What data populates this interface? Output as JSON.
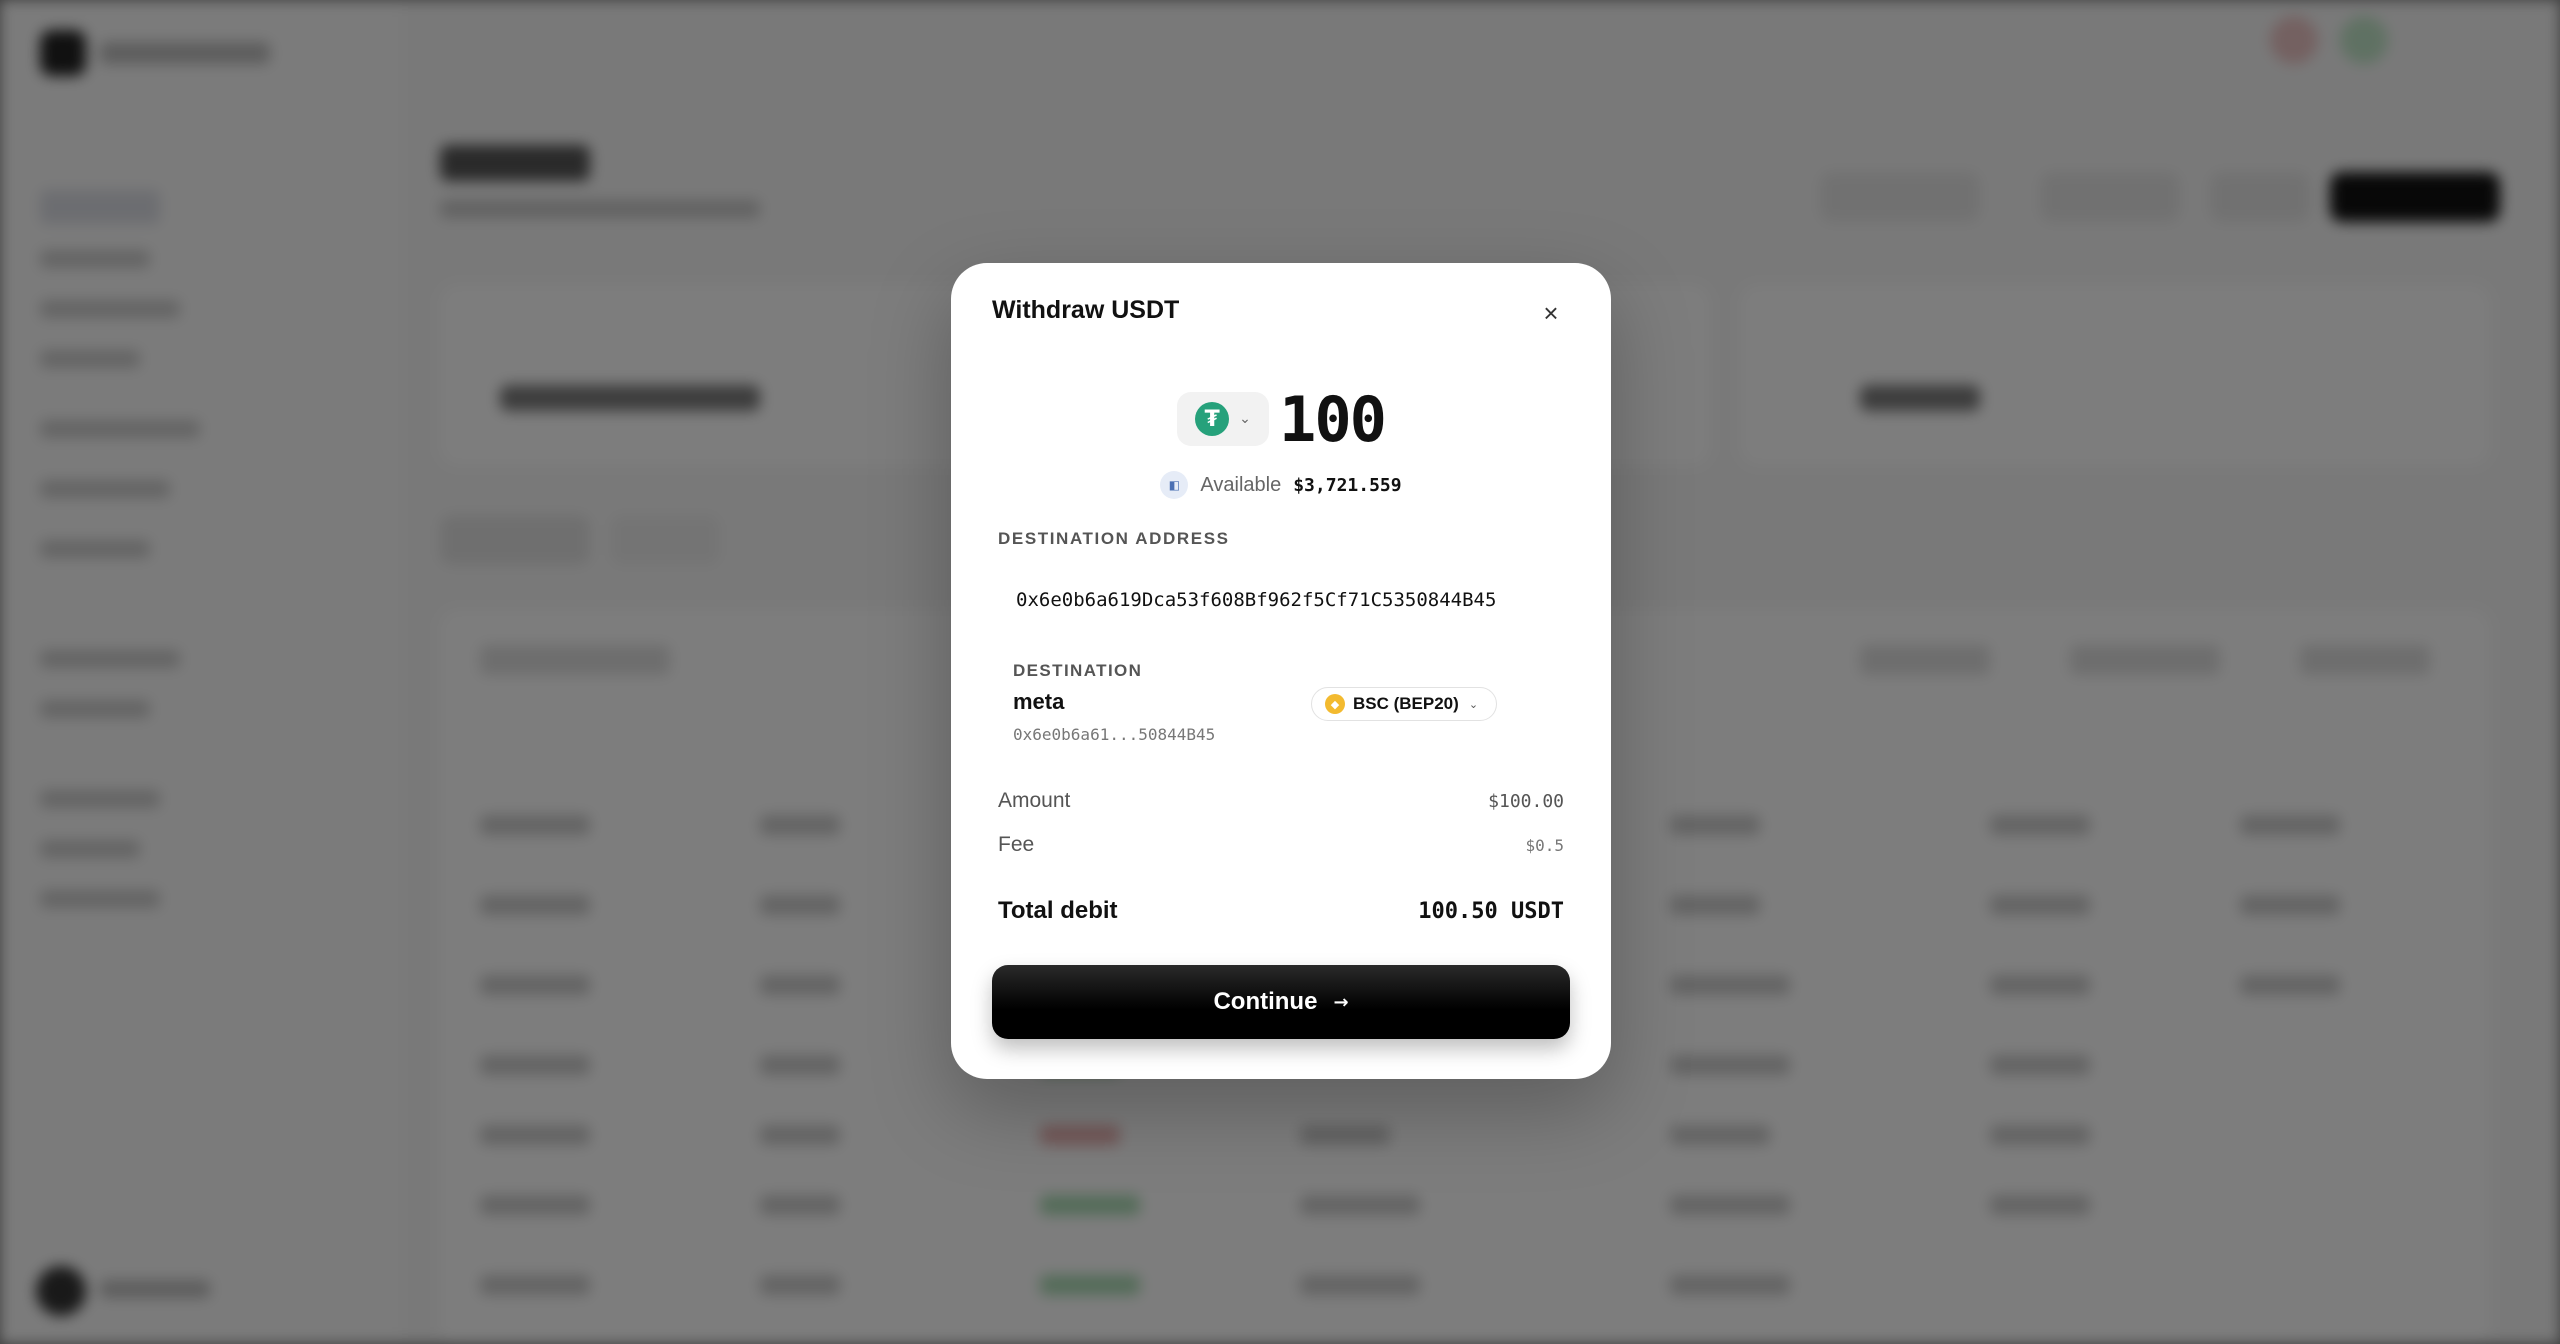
{
  "modal": {
    "title": "Withdraw USDT",
    "close_icon": "close-icon",
    "token": {
      "icon": "usdt-icon",
      "chevron": "chevron-down-icon"
    },
    "amount": "100",
    "available": {
      "label": "Available",
      "value": "$3,721.559",
      "icon": "wallet-icon"
    },
    "destination_address": {
      "label": "DESTINATION ADDRESS",
      "value": "0x6e0b6a619Dca53f608Bf962f5Cf71C5350844B45"
    },
    "destination": {
      "label": "DESTINATION",
      "name": "meta",
      "short_address": "0x6e0b6a61...50844B45",
      "network": {
        "label": "BSC (BEP20)",
        "icon": "bnb-icon"
      }
    },
    "summary": {
      "amount_label": "Amount",
      "amount_value": "$100.00",
      "fee_label": "Fee",
      "fee_value": "$0.5"
    },
    "total": {
      "label": "Total debit",
      "value": "100.50 USDT"
    },
    "continue_label": "Continue"
  },
  "colors": {
    "usdt": "#26a17b",
    "bnb": "#f3ba2f",
    "primary_button": "#000000",
    "overlay": "#000000"
  }
}
